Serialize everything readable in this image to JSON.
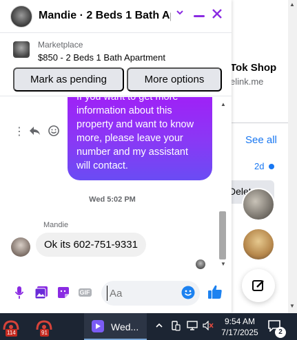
{
  "chat": {
    "title": "Mandie · 2 Beds 1 Bath Ap...",
    "marketplace_label": "Marketplace",
    "listing": "$850 - 2 Beds 1 Bath Apartment",
    "buttons": {
      "pending": "Mark as pending",
      "more": "More options"
    },
    "outgoing_lines": [
      "If you want to get more",
      "information about this",
      "property and want to know",
      "more, please leave your",
      "number and my assistant",
      "will contact."
    ],
    "timestamp": "Wed 5:02 PM",
    "sender_name": "Mandie",
    "incoming_text": "Ok its 602-751-9331",
    "input_placeholder": "Aa",
    "accent_color": "#8a2be2"
  },
  "background": {
    "shop_title": "Tok Shop",
    "shop_subtitle": "elink.me",
    "see_all": "See all",
    "time": "2d",
    "deleted_snippet": "Delete"
  },
  "taskbar": {
    "badge_one": "114",
    "badge_two": "91",
    "active_window_label": "Wed...",
    "time": "9:54 AM",
    "date": "7/17/2025",
    "notification_count": "2"
  }
}
